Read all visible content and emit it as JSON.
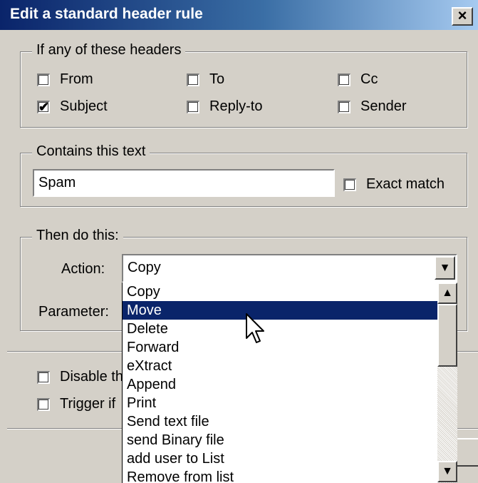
{
  "window": {
    "title": "Edit a standard header rule",
    "close_glyph": "×"
  },
  "headers_group": {
    "legend": "If any of these headers",
    "checkboxes": [
      {
        "label": "From",
        "checked": false
      },
      {
        "label": "To",
        "checked": false
      },
      {
        "label": "Cc",
        "checked": false
      },
      {
        "label": "Subject",
        "checked": true
      },
      {
        "label": "Reply-to",
        "checked": false
      },
      {
        "label": "Sender",
        "checked": false
      }
    ]
  },
  "contains_group": {
    "legend": "Contains this text",
    "text_value": "Spam",
    "exact_match_label": "Exact match",
    "exact_match_checked": false
  },
  "action_group": {
    "legend": "Then do this:",
    "action_label": "Action:",
    "action_value": "Copy",
    "parameter_label": "Parameter:"
  },
  "dropdown": {
    "options": [
      "Copy",
      "Move",
      "Delete",
      "Forward",
      "eXtract",
      "Append",
      "Print",
      "Send text file",
      "send Binary file",
      "add user to List",
      "Remove from list"
    ],
    "highlighted": "Move"
  },
  "bottom_options": {
    "disable_label": "Disable th",
    "trigger_label": "Trigger if"
  },
  "icons": {
    "checkmark": "✔",
    "dropdown_arrow": "▼",
    "scroll_up": "▲",
    "scroll_down": "▼"
  }
}
